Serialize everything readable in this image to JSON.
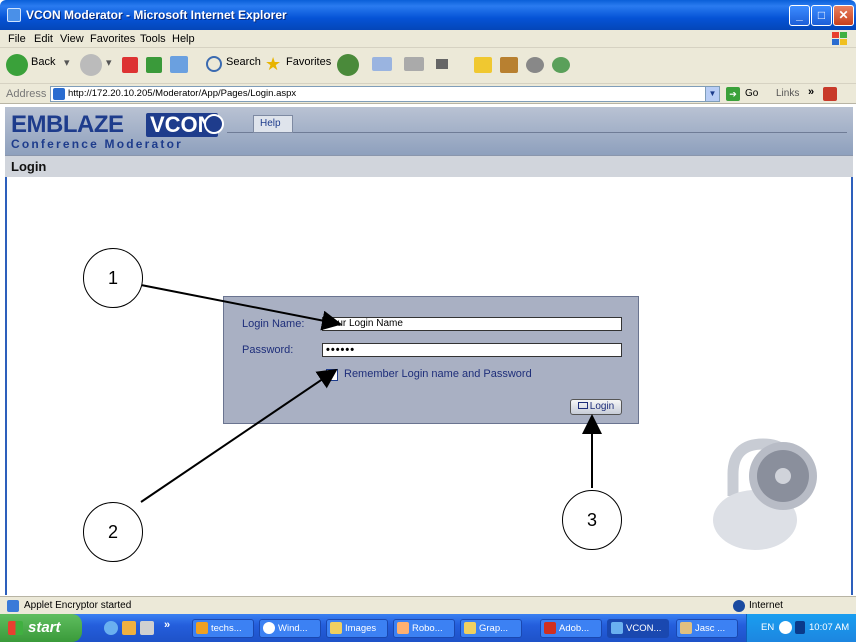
{
  "window": {
    "title": "VCON Moderator - Microsoft Internet Explorer"
  },
  "menu": [
    "File",
    "Edit",
    "View",
    "Favorites",
    "Tools",
    "Help"
  ],
  "toolbar": {
    "back_label": "Back",
    "search_label": "Search",
    "favorites_label": "Favorites"
  },
  "address": {
    "label": "Address",
    "url": "http://172.20.10.205/Moderator/App/Pages/Login.aspx",
    "go_label": "Go",
    "links_label": "Links"
  },
  "app": {
    "brand": "EMBLAZE",
    "brand_box": "VCON",
    "subtitle": "Conference Moderator",
    "help_tab": "Help",
    "page_title": "Login"
  },
  "login": {
    "login_name_label": "Login Name:",
    "login_name_value": "Your Login Name",
    "password_label": "Password:",
    "password_value": "••••••",
    "remember_label": "Remember Login name and Password",
    "remember_checked": true,
    "login_button": "Login"
  },
  "callouts": [
    "1",
    "2",
    "3"
  ],
  "status": {
    "text": "Applet Encryptor started",
    "zone": "Internet"
  },
  "taskbar": {
    "start": "start",
    "buttons": [
      "techs...",
      "Wind...",
      "Images",
      "Robo...",
      "Grap...",
      "Adob...",
      "VCON...",
      "Jasc ..."
    ],
    "language": "EN",
    "clock": "10:07 AM"
  },
  "colors": {
    "brand_blue": "#1e3c8c",
    "panel_bg": "#a9b0c3",
    "xp_blue": "#245edc",
    "start_green": "#3a9a3a"
  }
}
